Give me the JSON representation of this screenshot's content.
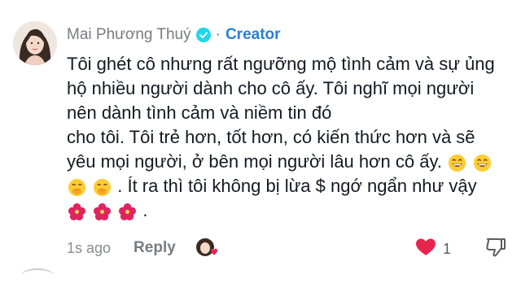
{
  "comment": {
    "username": "Mai Phương Thuý",
    "separator": "·",
    "badge": "Creator",
    "lines": [
      "Tôi ghét cô nhưng rất ngưỡng mộ tình cảm và sự ủng",
      "hộ nhiều người dành cho cô ấy. Tôi nghĩ mọi người",
      "nên dành tình cảm và niềm tin đó",
      "cho tôi. Tôi trẻ hơn, tốt hơn, có kiến thức hơn và sẽ",
      "yêu mọi người, ở bên mọi người lâu hơn cô ấy."
    ],
    "line6_text": ". Ít ra thì tôi không bị lừa $ ngớ ngẩn như vậy",
    "line7_text": "."
  },
  "footer": {
    "time": "1s ago",
    "reply_label": "Reply",
    "like_count": "1"
  },
  "icons": {
    "verified": "verified-check-icon",
    "grin": "grinning-emoji",
    "hand_over_mouth": "face-with-hand-over-mouth-emoji",
    "hibiscus": "hibiscus-emoji",
    "heart": "heart-icon",
    "dislike": "thumbs-down-icon"
  },
  "colors": {
    "accent": "#2a7fd4",
    "heart": "#e8254f",
    "muted": "#7a7b82"
  }
}
